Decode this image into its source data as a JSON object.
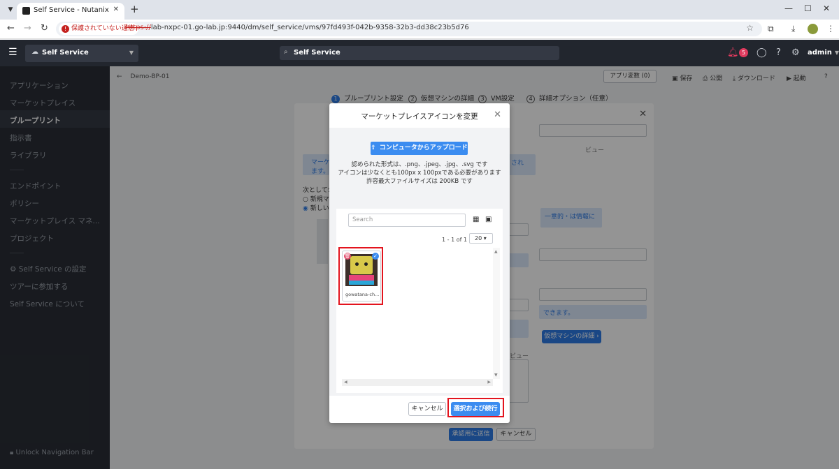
{
  "browser": {
    "tab_title": "Self Service - Nutanix",
    "insecure_label": "保護されていない通信",
    "url_scheme": "https://",
    "url_rest": "lab-nxpc-01.go-lab.jp:9440/dm/self_service/vms/97fd493f-042b-9358-32b3-dd38c23b5d76"
  },
  "header": {
    "app_name": "Self Service",
    "search_text": "Self Service",
    "alert_count": "5",
    "user": "admin"
  },
  "sidebar": {
    "items": [
      "アプリケーション",
      "マーケットプレイス",
      "ブループリント",
      "指示書",
      "ライブラリ",
      "エンドポイント",
      "ポリシー",
      "マーケットプレイス マネ...",
      "プロジェクト",
      "Self Service の設定",
      "ツアーに参加する",
      "Self Service について"
    ],
    "active_index": 2,
    "unlock": "Unlock Navigation Bar"
  },
  "page": {
    "breadcrumb": "Demo-BP-01",
    "app_change": "アプリ変数 (0)",
    "save": "保存",
    "publish": "公開",
    "download": "ダウンロード",
    "launch": "起動",
    "help": "?",
    "steps": [
      {
        "num": "1",
        "label": "ブループリント設定"
      },
      {
        "num": "2",
        "label": "仮想マシンの詳細"
      },
      {
        "num": "3",
        "label": "VM設定"
      },
      {
        "num": "4",
        "label": "詳細オプション（任意）"
      }
    ]
  },
  "bg_dialog": {
    "info_text_1": "マーケ",
    "info_text_2": "ます。",
    "info_right": "され",
    "next_label": "次として公",
    "radio_1": "新規マ",
    "radio_2": "新しい",
    "preview_label": "ビュー",
    "blue_note": "一意的・は情報に",
    "can_text": "できます。",
    "next_btn": "仮想マシンの詳細 ›",
    "submit": "承認用に送信",
    "cancel": "キャンセル"
  },
  "modal": {
    "title": "マーケットプレイスアイコンを変更",
    "upload_button": "コンピュータからアップロード",
    "note_formats": "認められた形式は、.png、.jpeg、.jpg、.svg です",
    "note_size": "アイコンは少なくとも100px x 100pxである必要があります",
    "note_max": "許容最大ファイルサイズは 200KB です",
    "search_placeholder": "Search",
    "pager": "1 - 1 of 1",
    "per_page": "20",
    "icons": [
      {
        "name": "gowatana-ch..."
      }
    ],
    "cancel": "キャンセル",
    "confirm": "選択および続行"
  },
  "colors": {
    "accent": "#3b8cf0",
    "highlight": "#e3141e",
    "header_bg": "#22262e"
  }
}
